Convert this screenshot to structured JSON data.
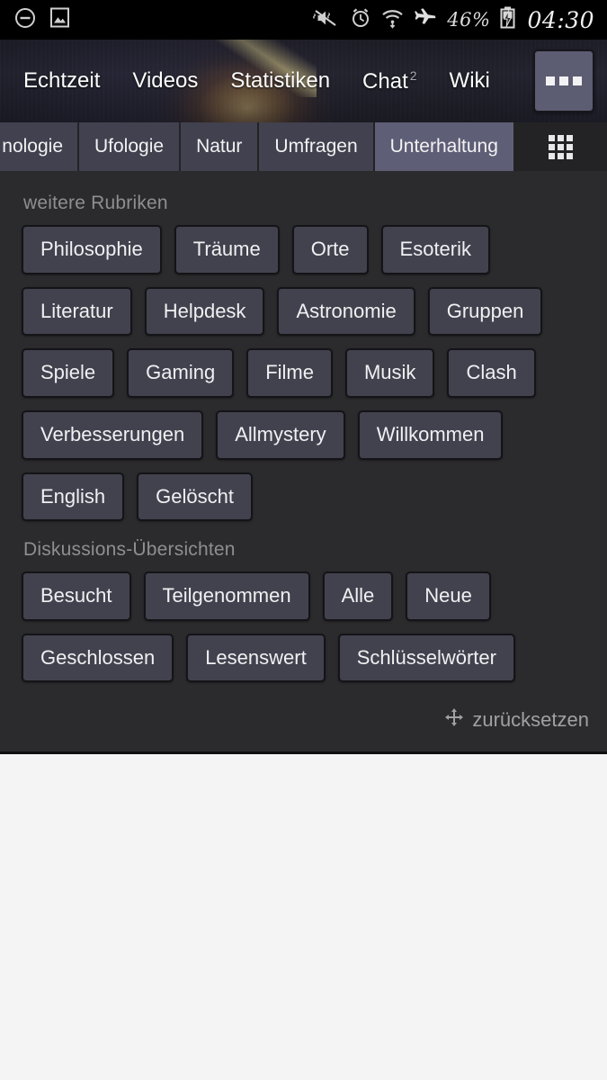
{
  "statusbar": {
    "left_icons": [
      "do-not-disturb-icon",
      "screenshot-image-icon"
    ],
    "right_icons": [
      "volume-mute-vibrate-icon",
      "alarm-clock-icon",
      "wifi-icon",
      "airplane-mode-icon"
    ],
    "battery_percent": "46%",
    "battery_icon": "battery-charging-icon",
    "clock": "04:30"
  },
  "header": {
    "nav": [
      {
        "label": "Echtzeit"
      },
      {
        "label": "Videos"
      },
      {
        "label": "Statistiken"
      },
      {
        "label": "Chat",
        "badge": "2"
      },
      {
        "label": "Wiki"
      }
    ],
    "more_button": "overflow-menu-icon"
  },
  "tabs": {
    "items": [
      {
        "label": "nologie",
        "active": false,
        "clipped": true
      },
      {
        "label": "Ufologie",
        "active": false
      },
      {
        "label": "Natur",
        "active": false
      },
      {
        "label": "Umfragen",
        "active": false
      },
      {
        "label": "Unterhaltung",
        "active": true
      }
    ],
    "grid_button": "grid-view-icon"
  },
  "panel": {
    "sections": [
      {
        "title": "weitere Rubriken",
        "rows": [
          [
            "Philosophie",
            "Träume",
            "Orte",
            "Esoterik"
          ],
          [
            "Literatur",
            "Helpdesk",
            "Astronomie",
            "Gruppen"
          ],
          [
            "Spiele",
            "Gaming",
            "Filme",
            "Musik",
            "Clash"
          ],
          [
            "Verbesserungen",
            "Allmystery",
            "Willkommen"
          ],
          [
            "English",
            "Gelöscht"
          ]
        ]
      },
      {
        "title": "Diskussions-Übersichten",
        "rows": [
          [
            "Besucht",
            "Teilgenommen",
            "Alle",
            "Neue"
          ],
          [
            "Geschlossen",
            "Lesenswert",
            "Schlüsselwörter"
          ]
        ]
      }
    ],
    "reset": {
      "icon": "move-arrows-icon",
      "label": "zurücksetzen"
    }
  },
  "colors": {
    "panel_bg": "#2b2b2d",
    "chip_bg": "#42424f",
    "tab_bg": "#41414f",
    "tab_active_bg": "#5e5e76",
    "accent": "#5c5c72",
    "muted_text": "#8e8e93",
    "page_bg": "#f4f4f4"
  }
}
